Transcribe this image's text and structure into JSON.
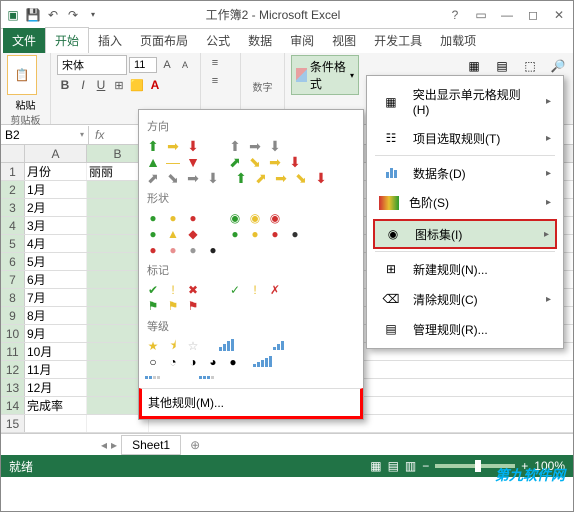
{
  "title": "工作簿2 - Microsoft Excel",
  "tabs": {
    "file": "文件",
    "home": "开始",
    "insert": "插入",
    "layout": "页面布局",
    "formulas": "公式",
    "data": "数据",
    "review": "审阅",
    "view": "视图",
    "dev": "开发工具",
    "addins": "加载项"
  },
  "ribbon": {
    "paste": "粘贴",
    "clipboard": "剪贴板",
    "font": "宋体",
    "size": "11",
    "number": "数字",
    "cf": "条件格式"
  },
  "namebox": "B2",
  "columns": [
    "A",
    "B"
  ],
  "rows": [
    {
      "n": "1",
      "a": "月份",
      "b": "丽丽"
    },
    {
      "n": "2",
      "a": "1月",
      "b": ""
    },
    {
      "n": "3",
      "a": "2月",
      "b": ""
    },
    {
      "n": "4",
      "a": "3月",
      "b": ""
    },
    {
      "n": "5",
      "a": "4月",
      "b": ""
    },
    {
      "n": "6",
      "a": "5月",
      "b": ""
    },
    {
      "n": "7",
      "a": "6月",
      "b": ""
    },
    {
      "n": "8",
      "a": "7月",
      "b": ""
    },
    {
      "n": "9",
      "a": "8月",
      "b": ""
    },
    {
      "n": "10",
      "a": "9月",
      "b": ""
    },
    {
      "n": "11",
      "a": "10月",
      "b": ""
    },
    {
      "n": "12",
      "a": "11月",
      "b": ""
    },
    {
      "n": "13",
      "a": "12月",
      "b": ""
    },
    {
      "n": "14",
      "a": "完成率",
      "b": ""
    },
    {
      "n": "15",
      "a": "",
      "b": ""
    }
  ],
  "sheet": "Sheet1",
  "status": {
    "ready": "就绪",
    "zoom": "100%"
  },
  "iconMenu": {
    "direction": "方向",
    "shapes": "形状",
    "marks": "标记",
    "ratings": "等级",
    "other": "其他规则(M)..."
  },
  "cfMenu": {
    "highlight": "突出显示单元格规则(H)",
    "toprules": "项目选取规则(T)",
    "databars": "数据条(D)",
    "colorscales": "色阶(S)",
    "iconsets": "图标集(I)",
    "newrule": "新建规则(N)...",
    "clear": "清除规则(C)",
    "manage": "管理规则(R)..."
  },
  "watermark": "第九软件网"
}
